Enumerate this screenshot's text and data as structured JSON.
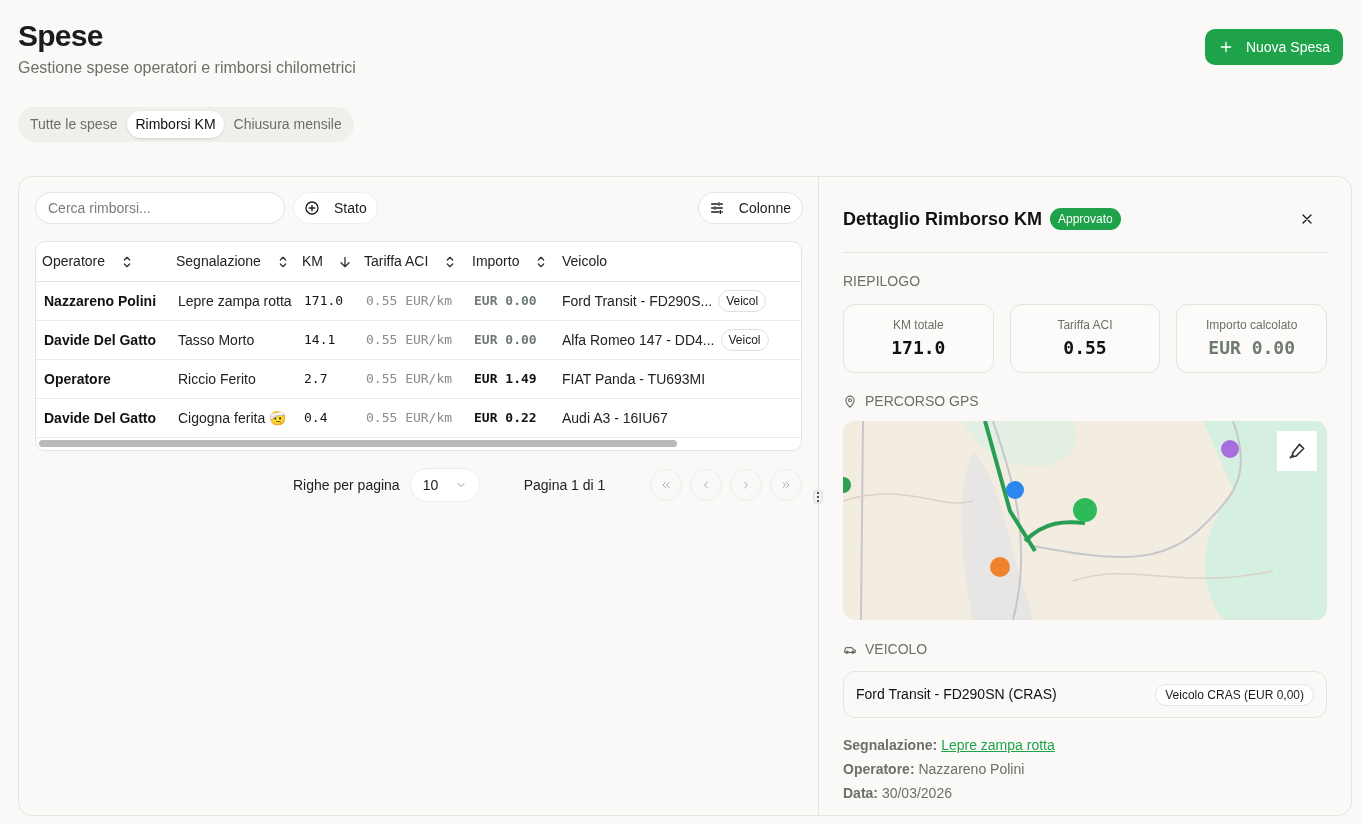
{
  "header": {
    "title": "Spese",
    "subtitle": "Gestione spese operatori e rimborsi chilometrici",
    "new_button": "Nuova Spesa"
  },
  "tabs": [
    {
      "label": "Tutte le spese",
      "selected": false
    },
    {
      "label": "Rimborsi KM",
      "selected": true
    },
    {
      "label": "Chiusura mensile",
      "selected": false
    }
  ],
  "toolbar": {
    "search": {
      "placeholder": "Cerca rimborsi..."
    },
    "filter_button": "Stato",
    "columns_button": "Colonne"
  },
  "table": {
    "columns": [
      {
        "label": "Operatore",
        "sortable": true,
        "sorted_descending": false
      },
      {
        "label": "Segnalazione",
        "sortable": true,
        "sorted_descending": false
      },
      {
        "label": "KM",
        "sortable": true,
        "sorted_descending": true
      },
      {
        "label": "Tariffa ACI",
        "sortable": true,
        "sorted_descending": false
      },
      {
        "label": "Importo",
        "sortable": true,
        "sorted_descending": false
      },
      {
        "label": "Veicolo",
        "sortable": false,
        "sorted_descending": false
      }
    ],
    "rows": [
      {
        "operatore": "Nazzareno Polini",
        "segnalazione": "Lepre zampa rotta",
        "km": "171.0",
        "tariffa": "0.55 EUR/km",
        "importo": "EUR 0.00",
        "importo_dimmed": true,
        "veicolo": "Ford Transit - FD290S...",
        "badge": "Veicol"
      },
      {
        "operatore": "Davide Del Gatto",
        "segnalazione": "Tasso Morto",
        "km": "14.1",
        "tariffa": "0.55 EUR/km",
        "importo": "EUR 0.00",
        "importo_dimmed": true,
        "veicolo": "Alfa Romeo 147 - DD4...",
        "badge": "Veicol"
      },
      {
        "operatore": "Operatore",
        "segnalazione": "Riccio Ferito",
        "km": "2.7",
        "tariffa": "0.55 EUR/km",
        "importo": "EUR 1.49",
        "importo_dimmed": false,
        "veicolo": "FIAT Panda - TU693MI"
      },
      {
        "operatore": "Davide Del Gatto",
        "segnalazione": "Cigogna ferita 🤕",
        "km": "0.4",
        "tariffa": "0.55 EUR/km",
        "importo": "EUR 0.22",
        "importo_dimmed": false,
        "veicolo": "Audi A3 - 16IU67"
      }
    ]
  },
  "pagination": {
    "rows_label": "Righe per pagina",
    "rows_value": "10",
    "page_label": "Pagina 1 di 1"
  },
  "detail": {
    "title": "Dettaglio Rimborso KM",
    "status": "Approvato",
    "summary_heading": "RIEPILOGO",
    "stats": [
      {
        "label": "KM totale",
        "value": "171.0",
        "dimmed": false
      },
      {
        "label": "Tariffa ACI",
        "value": "0.55",
        "dimmed": false
      },
      {
        "label": "Importo calcolato",
        "value": "EUR 0.00",
        "dimmed": true
      }
    ],
    "gps_heading": "PERCORSO GPS",
    "vehicle_heading": "VEICOLO",
    "vehicle": {
      "name": "Ford Transit - FD290SN (CRAS)",
      "badge": "Veicolo CRAS (EUR 0,00)"
    },
    "info": [
      {
        "label": "Segnalazione:",
        "value": "Lepre zampa rotta",
        "kind": "link"
      },
      {
        "label": "Operatore:",
        "value": "Nazzareno Polini",
        "kind": "text"
      },
      {
        "label": "Data:",
        "value": "30/03/2026",
        "kind": "text"
      }
    ]
  }
}
